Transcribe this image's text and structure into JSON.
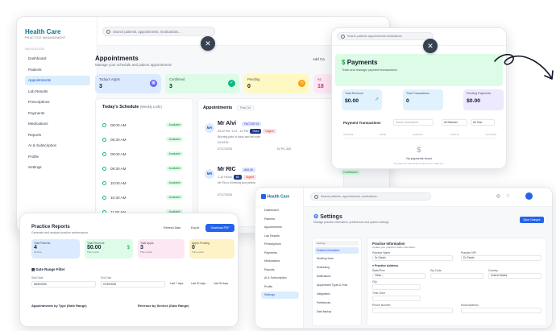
{
  "main": {
    "brand": "Health Care",
    "brand_sub": "PRACTICE MANAGEMENT",
    "nav_section": "NAVIGATION",
    "nav": [
      "Dashboard",
      "Patients",
      "Appointments",
      "Lab Results",
      "Prescriptions",
      "Payments",
      "Medications",
      "Reports",
      "AI & Subscription",
      "Profile",
      "Settings"
    ],
    "search_placeholder": "Search patients, appointments, medications...",
    "title": "Appointments",
    "subtitle": "Manage your schedule and patient appointments",
    "add_button": "Add Ca",
    "stats": [
      {
        "label": "Today's Appts",
        "value": "3",
        "color": "#dbeafe",
        "icon_color": "#6366f1"
      },
      {
        "label": "Confirmed",
        "value": "3",
        "color": "#dcfce7",
        "icon_color": "#10b981"
      },
      {
        "label": "Pending",
        "value": "0",
        "color": "#fef9c3",
        "icon_color": "#f59e0b"
      },
      {
        "label": "Ac",
        "value": "18",
        "color": "#fce7f3",
        "icon_color": "#ec4899"
      }
    ],
    "schedule_title": "Today's Schedule",
    "schedule_sub": "(Weekly Lorfe)",
    "slots": [
      "08:00 AM",
      "08:30 AM",
      "09:00 AM",
      "09:30 AM",
      "10:00 AM",
      "10:30 AM",
      "11:00 AM"
    ],
    "slot_status": "Available",
    "appointments_title": "Appointments",
    "appointments_filter": "Past 3d",
    "appt1": {
      "initials": "MA",
      "name": "Mr Alvi",
      "tag": "FACTOR 24",
      "type": "Tinea",
      "status": "Urgent",
      "time": "03:22 PM",
      "duration": "3:22 - 10 PM",
      "reason": "Burning pain in back and left side",
      "mrn": "04-0976...",
      "date": "07/17/2025",
      "provider": "Dr PC-345",
      "chip": "Confirmed"
    },
    "appt2": {
      "initials": "MR",
      "name": "Mr RIC",
      "tag": "AVA 45",
      "type": "6E",
      "status": "Urgent",
      "duration": "1-10 Hours",
      "reason": "Mr Ric is ill feeling and yellow",
      "date": "07/17/2025",
      "provider": "Dr PC-345",
      "chip": "Confirmed"
    }
  },
  "payments": {
    "search_placeholder": "Search patients appointments medications",
    "title": "Payments",
    "subtitle": "Track and manage payment transactions",
    "stats": [
      {
        "label": "Total Revenue",
        "value": "$0.00",
        "color": "#e0f2fe"
      },
      {
        "label": "Total Transactions",
        "value": "0",
        "color": "#e0f2fe"
      },
      {
        "label": "Pending Payments",
        "value": "$0.00",
        "color": "#ede9fe"
      }
    ],
    "transactions_title": "Payment Transactions",
    "search_txn": "Search transactions",
    "filter1": "All Statuses",
    "filter2": "All Time",
    "columns": [
      "INVOICE",
      "DATE",
      "AMOUNT",
      "STATUS",
      "ACTIONS"
    ],
    "empty_title": "No payments found",
    "empty_sub": "No payment transactions have been made yet."
  },
  "reports": {
    "title": "Practice Reports",
    "subtitle": "Generate and analyze practice performance",
    "refresh": "Refresh Data",
    "export": "Export",
    "download": "Download PDF",
    "stats": [
      {
        "label": "Total Patients",
        "value": "4",
        "sub": "All time",
        "color": "#dbeafe"
      },
      {
        "label": "Total Revenue",
        "value": "$0.00",
        "sub": "This month",
        "color": "#dcfce7"
      },
      {
        "label": "Total Appts",
        "value": "3",
        "sub": "This month",
        "color": "#fce7f3"
      },
      {
        "label": "Appts Pending",
        "value": "0",
        "sub": "This month",
        "color": "#fef3c7"
      }
    ],
    "date_range": "Date Range Filter",
    "from_label": "Start Date",
    "from": "06/30/2025",
    "to_label": "End Date",
    "to": "07/30/2025",
    "btn1": "Last 7 days",
    "btn2": "Last 30 days",
    "btn3": "Last 90 days",
    "chart1": "Appointments by Type (Date Range)",
    "chart2": "Revenue by Service (Date Range)"
  },
  "settings": {
    "brand": "Health Care",
    "search_placeholder": "Search patients, appointments, medications...",
    "nav": [
      "Dashboard",
      "Patients",
      "Appointments",
      "Lab Results",
      "Prescriptions",
      "Payments",
      "Medications",
      "Reports",
      "AI & Subscription",
      "Profile",
      "Settings"
    ],
    "title": "Settings",
    "subtitle": "Manage practice information, preferences and system settings",
    "save": "Save Changes",
    "side_tab_header": "Settings",
    "side_tabs": [
      "Practice Information",
      "Working Hours",
      "Scheduling",
      "Notifications",
      "Appointment Types & Fees",
      "Integrations",
      "Preferences",
      "Data Backup"
    ],
    "form_title": "Practice Information",
    "form_sub": "Update your practice's basic information",
    "practice_name_label": "Practice Name",
    "practice_name": "Dr Sarah",
    "npi_label": "Practice NPI",
    "npi": "Dr Sarah",
    "address_title": "Practice Address",
    "state_label": "State/Prov",
    "state": "Other ...",
    "zip_label": "Zip Code",
    "city_label": "City",
    "country_label": "Country",
    "country": "United States",
    "time_zone_label": "Time Zone",
    "phone_label": "Phone Number",
    "email_label": "Email Address"
  }
}
